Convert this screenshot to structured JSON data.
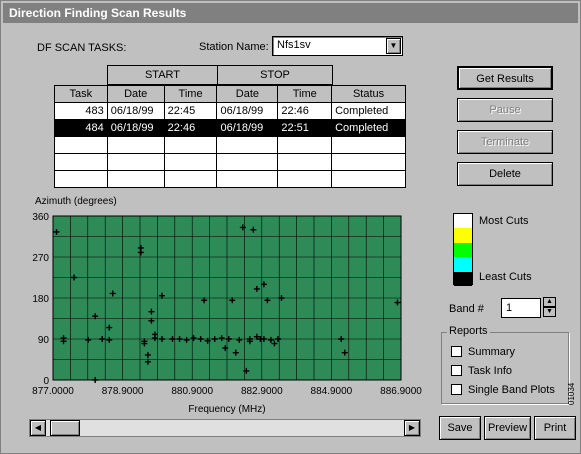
{
  "window": {
    "title": "Direction Finding Scan Results"
  },
  "tasks_section": {
    "label": "DF SCAN TASKS:",
    "station_label": "Station Name:",
    "station_value": "Nfs1sv"
  },
  "table": {
    "group_headers": [
      "START",
      "STOP"
    ],
    "columns": [
      "Task",
      "Date",
      "Time",
      "Date",
      "Time",
      "Status"
    ],
    "rows": [
      [
        "483",
        "06/18/99",
        "22:45",
        "06/18/99",
        "22:46",
        "Completed"
      ],
      [
        "484",
        "06/18/99",
        "22:46",
        "06/18/99",
        "22:51",
        "Completed"
      ]
    ],
    "selected_row": 1
  },
  "buttons": {
    "get_results": "Get Results",
    "pause": "Pause",
    "terminate": "Terminate",
    "delete": "Delete",
    "save": "Save",
    "preview": "Preview",
    "print": "Print"
  },
  "legend": {
    "most": "Most Cuts",
    "least": "Least Cuts",
    "colors": [
      "#ffffff",
      "#ffff00",
      "#00ff00",
      "#00ffff",
      "#000000"
    ]
  },
  "band": {
    "label": "Band #",
    "value": "1"
  },
  "reports": {
    "title": "Reports",
    "options": [
      "Summary",
      "Task Info",
      "Single Band Plots"
    ]
  },
  "side_code": "01034",
  "chart_data": {
    "type": "scatter",
    "xlabel": "Frequency (MHz)",
    "ylabel": "Azimuth (degrees)",
    "xlim": [
      877.0,
      886.9
    ],
    "ylim": [
      0,
      360
    ],
    "x_ticks": [
      "877.0000",
      "878.9000",
      "880.9000",
      "882.9000",
      "884.9000",
      "886.9000"
    ],
    "y_ticks": [
      "360",
      "270",
      "180",
      "90",
      "0"
    ],
    "grid": true,
    "background": "#2e8b57",
    "marker_color": "#000000",
    "points": [
      [
        877.1,
        325
      ],
      [
        877.3,
        85
      ],
      [
        877.3,
        92
      ],
      [
        877.6,
        225
      ],
      [
        878.0,
        88
      ],
      [
        878.2,
        140
      ],
      [
        878.4,
        90
      ],
      [
        878.6,
        115
      ],
      [
        878.6,
        88
      ],
      [
        878.7,
        190
      ],
      [
        878.2,
        0
      ],
      [
        879.5,
        290
      ],
      [
        879.5,
        280
      ],
      [
        879.6,
        85
      ],
      [
        879.6,
        80
      ],
      [
        879.8,
        150
      ],
      [
        879.8,
        130
      ],
      [
        879.9,
        100
      ],
      [
        879.9,
        92
      ],
      [
        879.7,
        40
      ],
      [
        879.7,
        55
      ],
      [
        880.1,
        185
      ],
      [
        880.1,
        90
      ],
      [
        880.4,
        90
      ],
      [
        880.6,
        90
      ],
      [
        880.8,
        88
      ],
      [
        881.0,
        92
      ],
      [
        881.2,
        90
      ],
      [
        881.3,
        175
      ],
      [
        881.4,
        86
      ],
      [
        881.6,
        90
      ],
      [
        881.8,
        92
      ],
      [
        881.9,
        70
      ],
      [
        882.0,
        90
      ],
      [
        882.1,
        175
      ],
      [
        882.2,
        60
      ],
      [
        882.3,
        88
      ],
      [
        882.4,
        335
      ],
      [
        882.5,
        20
      ],
      [
        882.6,
        90
      ],
      [
        882.7,
        330
      ],
      [
        882.8,
        200
      ],
      [
        882.9,
        90
      ],
      [
        883.0,
        210
      ],
      [
        883.0,
        90
      ],
      [
        883.1,
        175
      ],
      [
        883.2,
        88
      ],
      [
        883.3,
        80
      ],
      [
        883.4,
        90
      ],
      [
        883.5,
        180
      ],
      [
        882.8,
        95
      ],
      [
        882.6,
        85
      ],
      [
        885.2,
        90
      ],
      [
        885.3,
        60
      ],
      [
        886.8,
        170
      ]
    ]
  }
}
